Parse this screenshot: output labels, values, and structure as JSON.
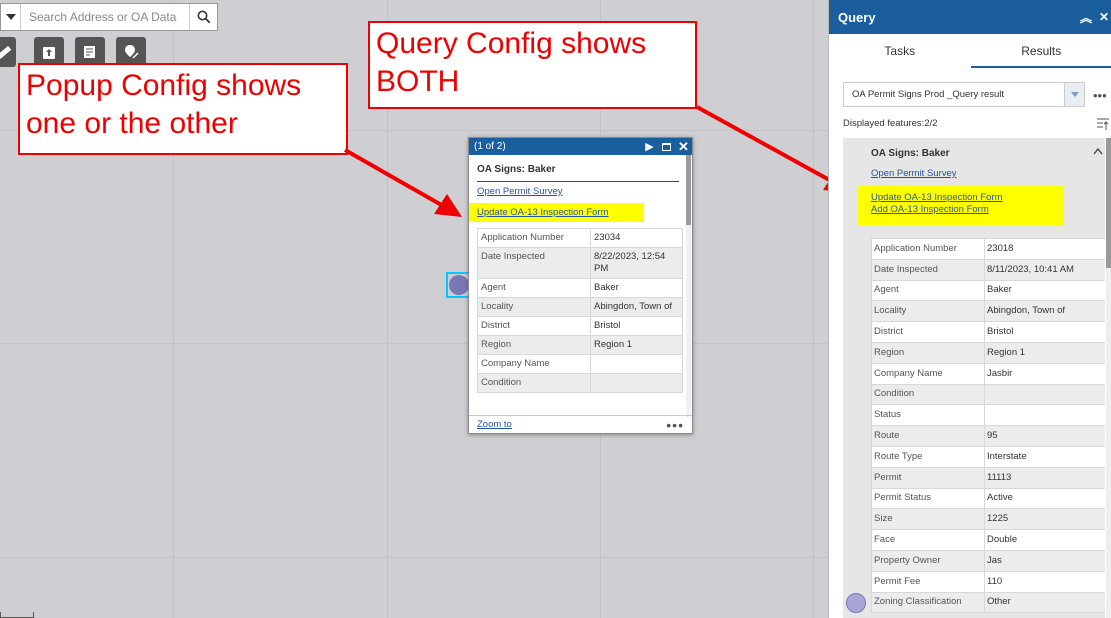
{
  "map": {
    "search_placeholder": "Search Address or OA Data",
    "tools": [
      "ruler-icon",
      "clipboard-upload-icon",
      "edit-form-icon",
      "edit-pin-icon"
    ]
  },
  "callouts": {
    "popup_line1": "Popup Config shows",
    "popup_line2": "one or the other",
    "query_line1": "Query Config shows",
    "query_line2": "BOTH"
  },
  "popup": {
    "count": "(1 of 2)",
    "title": "OA Signs: Baker",
    "link_survey": "Open Permit Survey",
    "link_update": "Update OA-13 Inspection Form",
    "attributes": [
      {
        "k": "Application Number",
        "v": "23034"
      },
      {
        "k": "Date Inspected",
        "v": "8/22/2023, 12:54 PM"
      },
      {
        "k": "Agent",
        "v": "Baker"
      },
      {
        "k": "Locality",
        "v": "Abingdon, Town of"
      },
      {
        "k": "District",
        "v": "Bristol"
      },
      {
        "k": "Region",
        "v": "Region 1"
      },
      {
        "k": "Company Name",
        "v": ""
      },
      {
        "k": "Condition",
        "v": ""
      }
    ],
    "zoom_to": "Zoom to"
  },
  "panel": {
    "title": "Query",
    "tabs": [
      "Tasks",
      "Results"
    ],
    "result_select": "OA Permit Signs Prod _Query result",
    "displayed": "Displayed features:2/2",
    "result_title": "OA Signs: Baker",
    "link_survey": "Open Permit Survey",
    "link_update": "Update OA-13 Inspection Form",
    "link_add": "Add OA-13 Inspection Form",
    "attributes": [
      {
        "k": "Application Number",
        "v": "23018"
      },
      {
        "k": "Date Inspected",
        "v": "8/11/2023, 10:41 AM"
      },
      {
        "k": "Agent",
        "v": "Baker"
      },
      {
        "k": "Locality",
        "v": "Abingdon, Town of"
      },
      {
        "k": "District",
        "v": "Bristol"
      },
      {
        "k": "Region",
        "v": "Region 1"
      },
      {
        "k": "Company Name",
        "v": "Jasbir"
      },
      {
        "k": "Condition",
        "v": ""
      },
      {
        "k": "Status",
        "v": ""
      },
      {
        "k": "Route",
        "v": "95"
      },
      {
        "k": "Route Type",
        "v": "Interstate"
      },
      {
        "k": "Permit",
        "v": "11113"
      },
      {
        "k": "Permit Status",
        "v": "Active"
      },
      {
        "k": "Size",
        "v": "1225"
      },
      {
        "k": "Face",
        "v": "Double"
      },
      {
        "k": "Property Owner",
        "v": "Jas"
      },
      {
        "k": "Permit Fee",
        "v": "110"
      },
      {
        "k": "Zoning Classification",
        "v": "Other"
      }
    ]
  },
  "colors": {
    "accent": "#1a5e9e",
    "highlight": "#ffff00",
    "callout": "#ee0000"
  }
}
